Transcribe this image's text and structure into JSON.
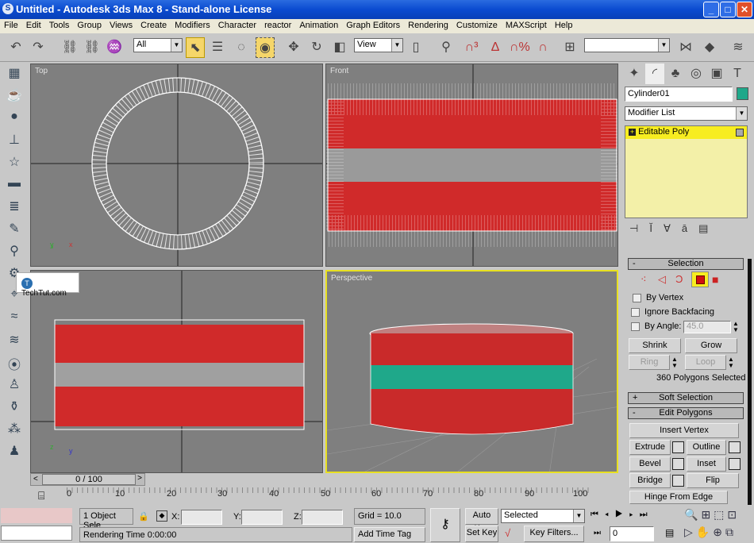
{
  "window": {
    "title": "Untitled - Autodesk 3ds Max 8  - Stand-alone License",
    "minimize": "_",
    "maximize": "□",
    "close": "✕"
  },
  "menu": [
    "File",
    "Edit",
    "Tools",
    "Group",
    "Views",
    "Create",
    "Modifiers",
    "Character",
    "reactor",
    "Animation",
    "Graph Editors",
    "Rendering",
    "Customize",
    "MAXScript",
    "Help"
  ],
  "toolbar": {
    "selection_filter": "All",
    "reference_coord": "View",
    "named_selection": ""
  },
  "viewports": {
    "top": "Top",
    "front": "Front",
    "left": "",
    "perspective": "Perspective"
  },
  "watermark": "TechTut.com",
  "command_panel": {
    "object_name": "Cylinder01",
    "object_color": "#1fa88a",
    "modifier_list": "Modifier List",
    "stack": [
      {
        "label": "Editable Poly",
        "expander": "+"
      }
    ],
    "selection": {
      "title": "Selection",
      "collapse": "-",
      "by_vertex": "By Vertex",
      "ignore_backfacing": "Ignore Backfacing",
      "by_angle": "By Angle:",
      "angle_value": "45.0",
      "shrink": "Shrink",
      "grow": "Grow",
      "ring": "Ring",
      "loop": "Loop",
      "status": "360 Polygons Selected",
      "active_level": "polygon"
    },
    "soft_selection": {
      "title": "Soft Selection",
      "expand": "+"
    },
    "edit_polygons": {
      "title": "Edit Polygons",
      "collapse": "-",
      "buttons": [
        "Insert Vertex",
        "Extrude",
        "Outline",
        "Bevel",
        "Inset",
        "Bridge",
        "Flip",
        "Hinge From Edge"
      ]
    }
  },
  "timeline": {
    "slider": "0 / 100",
    "ticks": [
      "0",
      "10",
      "20",
      "30",
      "40",
      "50",
      "60",
      "70",
      "80",
      "90",
      "100"
    ]
  },
  "status": {
    "selection": "1 Object Sele",
    "x_label": "X:",
    "y_label": "Y:",
    "z_label": "Z:",
    "x": "",
    "y": "",
    "z": "",
    "grid": "Grid = 10.0",
    "add_time_tag": "Add Time Tag",
    "prompt": "Rendering Time  0:00:00"
  },
  "animation": {
    "auto_key": "Auto Key",
    "set_key": "Set Key",
    "key_mode": "Selected",
    "key_filters": "Key Filters...",
    "current_frame": "0"
  }
}
